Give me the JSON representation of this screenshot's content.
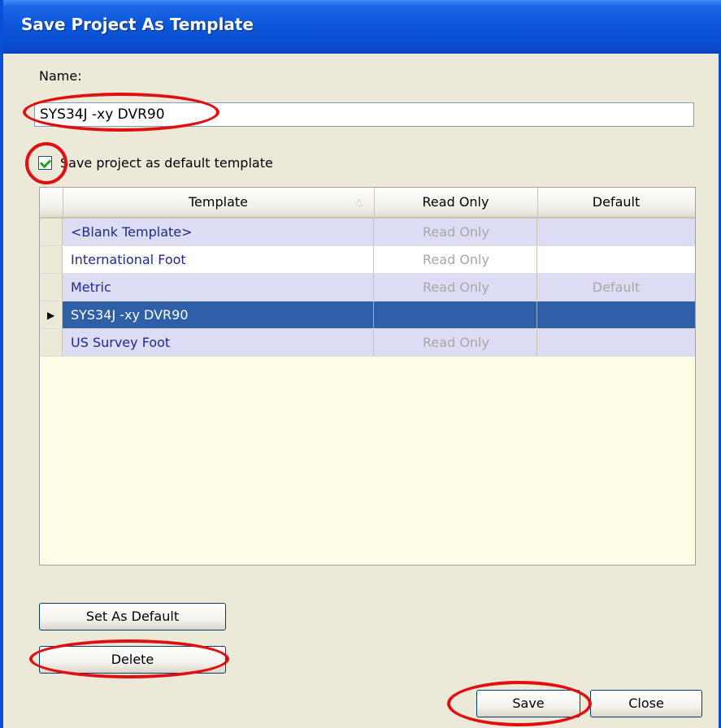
{
  "window": {
    "title": "Save Project As Template"
  },
  "name_field": {
    "label": "Name:",
    "value": "SYS34J -xy DVR90"
  },
  "default_checkbox": {
    "label": "Save project as default template",
    "checked": true
  },
  "grid": {
    "columns": {
      "template": "Template",
      "read_only": "Read Only",
      "default": "Default"
    },
    "rows": [
      {
        "template": "<Blank Template>",
        "read_only": "Read Only",
        "default": ""
      },
      {
        "template": "International Foot",
        "read_only": "Read Only",
        "default": ""
      },
      {
        "template": "Metric",
        "read_only": "Read Only",
        "default": "Default"
      },
      {
        "template": "SYS34J -xy DVR90",
        "read_only": "",
        "default": "",
        "selected": true
      },
      {
        "template": "US Survey Foot",
        "read_only": "Read Only",
        "default": ""
      }
    ]
  },
  "buttons": {
    "set_default": "Set As Default",
    "delete": "Delete",
    "save": "Save",
    "close": "Close"
  },
  "colors": {
    "annotation": "#e01010",
    "selection": "#2f5fa6",
    "title_bar": "#0b54d8"
  }
}
